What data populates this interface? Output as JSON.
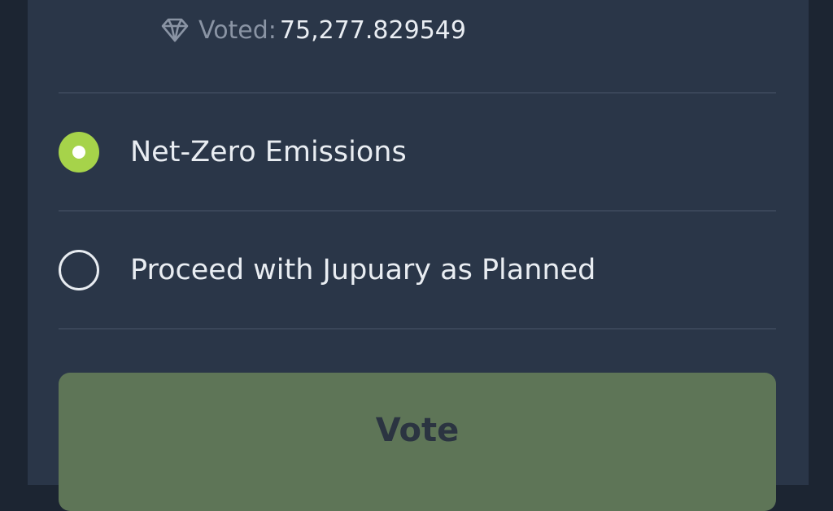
{
  "stats": {
    "icon": "gem-icon",
    "voted_label": "Voted:",
    "voted_value": "75,277.829549"
  },
  "options": [
    {
      "label": "Net-Zero Emissions",
      "selected": true
    },
    {
      "label": "Proceed with Jupuary as Planned",
      "selected": false
    }
  ],
  "vote_button": {
    "label": "Vote"
  },
  "colors": {
    "background": "#1c2532",
    "panel": "#2a3648",
    "accent_selected": "#a6d34a",
    "button_bg": "#5e7557",
    "button_text": "#2b3441",
    "text_primary": "#e9edf2",
    "text_muted": "#8a94a4",
    "divider": "#3a4659"
  }
}
